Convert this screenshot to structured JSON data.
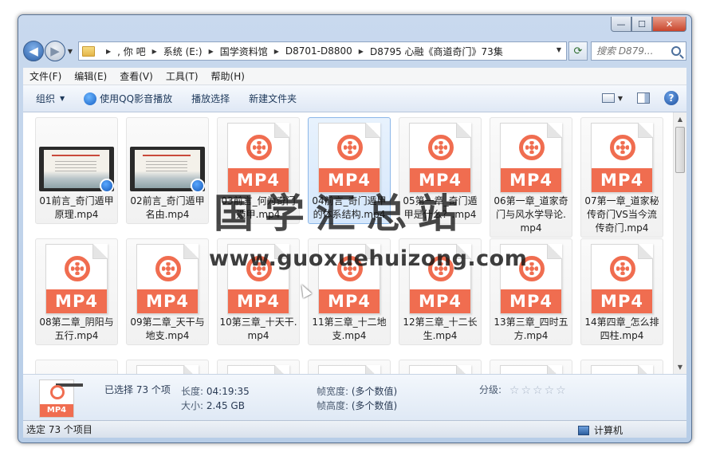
{
  "window": {
    "caption": {
      "minimize": "—",
      "maximize": "☐",
      "close": "✕"
    }
  },
  "address": {
    "breadcrumbs": [
      ", 你   吧",
      "系统 (E:)",
      "国学资料馆",
      "D8701-D8800",
      "D8795 心融《商道奇门》73集"
    ],
    "search_placeholder": "搜索 D879..."
  },
  "menu": [
    "文件(F)",
    "编辑(E)",
    "查看(V)",
    "工具(T)",
    "帮助(H)"
  ],
  "toolbar": {
    "organize": "组织",
    "qq_play": "使用QQ影音播放",
    "play_selected": "播放选择",
    "new_folder": "新建文件夹"
  },
  "files": [
    {
      "name": "01前言_奇门遁甲原理.mp4",
      "type": "video",
      "selected": false
    },
    {
      "name": "02前言_奇门遁甲名由.mp4",
      "type": "video",
      "selected": false
    },
    {
      "name": "03前言_何为奇门遁甲.mp4",
      "type": "mp4",
      "selected": false
    },
    {
      "name": "04前言_奇门遁甲的体系结构.mp4",
      "type": "mp4",
      "selected": true
    },
    {
      "name": "05第一章_奇门遁甲是什么？.mp4",
      "type": "mp4",
      "selected": false
    },
    {
      "name": "06第一章_道家奇门与风水学导论.mp4",
      "type": "mp4",
      "selected": false
    },
    {
      "name": "07第一章_道家秘传奇门VS当今流传奇门.mp4",
      "type": "mp4",
      "selected": false
    },
    {
      "name": "08第二章_阴阳与五行.mp4",
      "type": "mp4",
      "selected": false
    },
    {
      "name": "09第二章_天干与地支.mp4",
      "type": "mp4",
      "selected": false
    },
    {
      "name": "10第三章_十天干.mp4",
      "type": "mp4",
      "selected": false
    },
    {
      "name": "11第三章_十二地支.mp4",
      "type": "mp4",
      "selected": false
    },
    {
      "name": "12第三章_十二长生.mp4",
      "type": "mp4",
      "selected": false
    },
    {
      "name": "13第三章_四时五方.mp4",
      "type": "mp4",
      "selected": false
    },
    {
      "name": "14第四章_怎么排四柱.mp4",
      "type": "mp4",
      "selected": false
    },
    {
      "name": "",
      "type": "blank",
      "selected": false
    },
    {
      "name": "",
      "type": "mp4",
      "selected": false
    },
    {
      "name": "",
      "type": "mp4",
      "selected": false
    },
    {
      "name": "",
      "type": "mp4",
      "selected": false
    },
    {
      "name": "",
      "type": "mp4",
      "selected": false
    },
    {
      "name": "",
      "type": "mp4",
      "selected": false
    },
    {
      "name": "",
      "type": "mp4",
      "selected": false
    }
  ],
  "badge_text": "MP4",
  "details": {
    "selected_count": "已选择 73 个项",
    "length_label": "长度:",
    "length_value": "04:19:35",
    "size_label": "大小:",
    "size_value": "2.45 GB",
    "frame_width_label": "帧宽度:",
    "frame_width_value": "(多个数值)",
    "frame_height_label": "帧高度:",
    "frame_height_value": "(多个数值)",
    "rating_label": "分级:",
    "rating_stars": 0,
    "thumb_badge": "MP4"
  },
  "status": {
    "left": "选定 73 个项目",
    "right": "计算机"
  },
  "watermark": {
    "title": "国学汇总站",
    "url": "www.guoxuehuizong.com"
  },
  "colors": {
    "mp4_accent": "#f06d50",
    "selection": "#d5e7fb",
    "chrome": "#b7cde7"
  }
}
